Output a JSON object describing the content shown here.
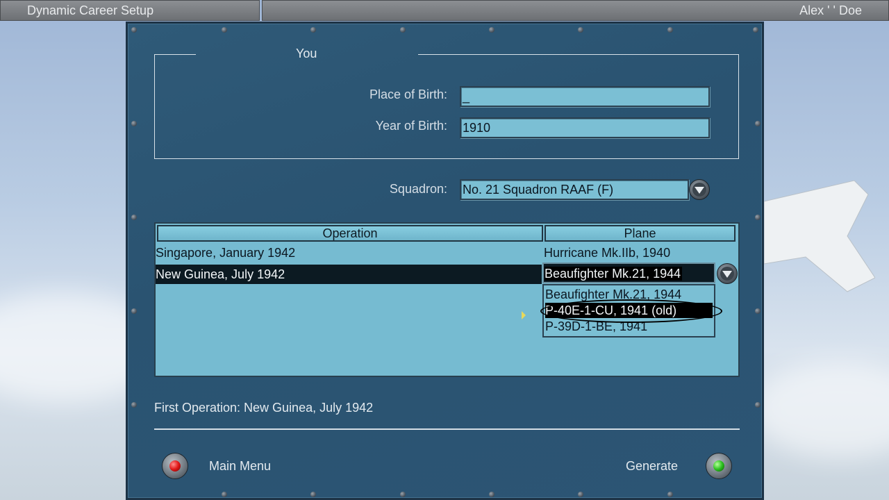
{
  "window": {
    "title": "Dynamic Career Setup",
    "player_name": "Alex ' ' Doe"
  },
  "you_section": {
    "title": "You",
    "place_of_birth_label": "Place of Birth:",
    "place_of_birth_value": "_",
    "year_of_birth_label": "Year of Birth:",
    "year_of_birth_value": "1910"
  },
  "squadron": {
    "label": "Squadron:",
    "value": "No. 21 Squadron RAAF (F)"
  },
  "table": {
    "columns": [
      "Operation",
      "Plane"
    ],
    "rows": [
      {
        "operation": "Singapore, January 1942",
        "plane": "Hurricane Mk.IIb, 1940"
      },
      {
        "operation": "New Guinea, July 1942",
        "plane": "Beaufighter Mk.21, 1944"
      }
    ],
    "selected_row": 1,
    "plane_options": [
      "Beaufighter Mk.21, 1944",
      "P-40E-1-CU, 1941 (old)",
      "P-39D-1-BE, 1941"
    ],
    "highlighted_option": 1
  },
  "first_operation": "First Operation: New Guinea, July 1942",
  "buttons": {
    "main_menu": "Main Menu",
    "generate": "Generate"
  },
  "colors": {
    "panel": "#2c5574",
    "field": "#7bbfd4",
    "selection": "#0c1a22"
  }
}
